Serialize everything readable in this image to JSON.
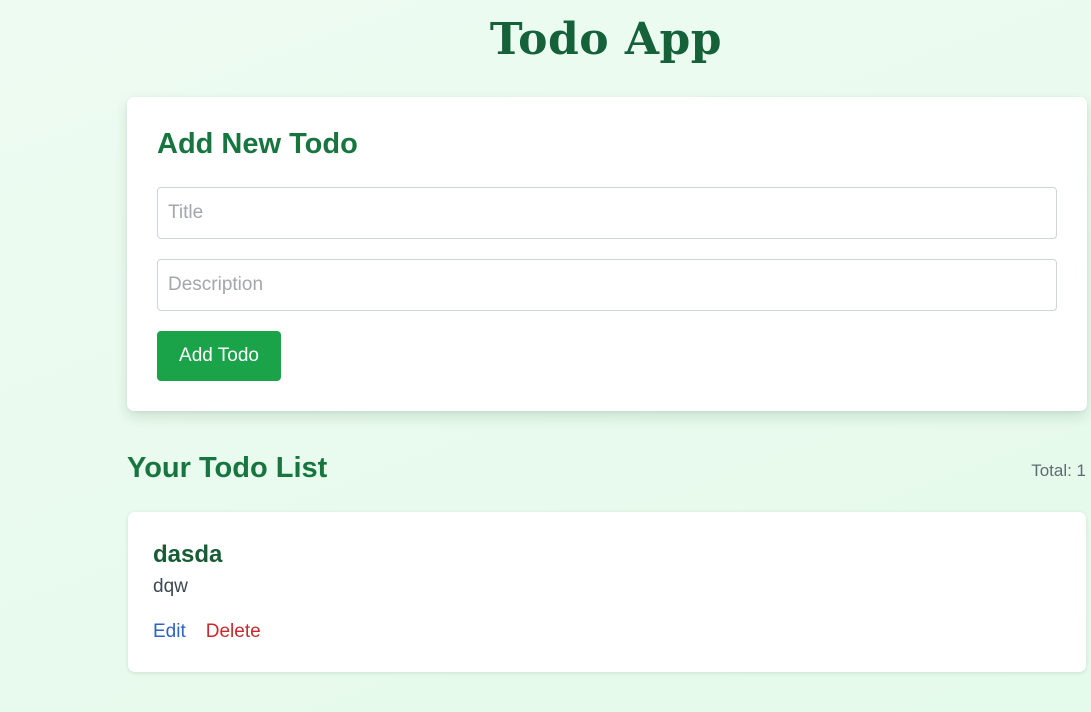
{
  "header": {
    "title": "Todo App"
  },
  "add_form": {
    "heading": "Add New Todo",
    "title_input": {
      "value": "",
      "placeholder": "Title"
    },
    "description_input": {
      "value": "",
      "placeholder": "Description"
    },
    "submit_label": "Add Todo"
  },
  "todo_list": {
    "heading": "Your Todo List",
    "total_label": "Total: 1",
    "items": [
      {
        "title": "dasda",
        "description": "dqw",
        "edit_label": "Edit",
        "delete_label": "Delete"
      }
    ]
  },
  "colors": {
    "primary_green": "#17763f",
    "button_green": "#1aa349",
    "edit_blue": "#2f62c4",
    "delete_red": "#c52b2b",
    "background": "#e8fbee"
  }
}
